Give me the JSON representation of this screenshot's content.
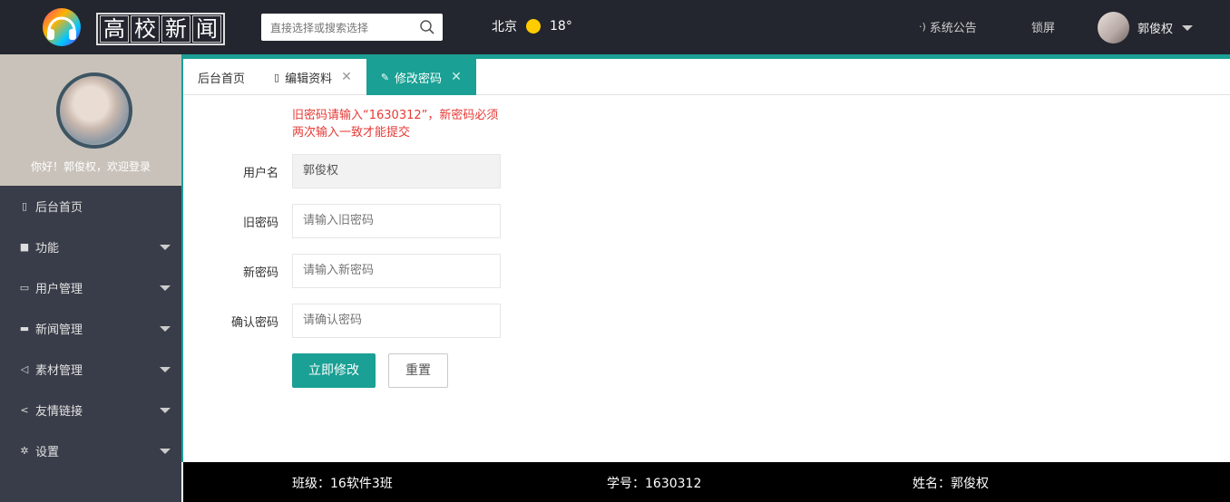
{
  "header": {
    "logo_chars": [
      "高",
      "校",
      "新",
      "闻"
    ],
    "search_placeholder": "直接选择或搜索选择",
    "weather_city": "北京",
    "weather_temp": "18°",
    "notice_label": "系统公告",
    "lock_label": "锁屏",
    "user_name": "郭俊权"
  },
  "sidebar": {
    "welcome": "你好！郭俊权，欢迎登录",
    "items": [
      {
        "label": "后台首页",
        "icon": "tablet-icon",
        "glyph": "▯",
        "has_arrow": false
      },
      {
        "label": "功能",
        "icon": "briefcase-icon",
        "glyph": "■",
        "has_arrow": true
      },
      {
        "label": "用户管理",
        "icon": "chat-icon",
        "glyph": "▭",
        "has_arrow": true
      },
      {
        "label": "新闻管理",
        "icon": "folder-icon",
        "glyph": "▬",
        "has_arrow": true
      },
      {
        "label": "素材管理",
        "icon": "paper-plane-icon",
        "glyph": "◁",
        "has_arrow": true
      },
      {
        "label": "友情链接",
        "icon": "share-icon",
        "glyph": "<",
        "has_arrow": true
      },
      {
        "label": "设置",
        "icon": "gear-icon",
        "glyph": "✲",
        "has_arrow": true
      }
    ]
  },
  "tabs": [
    {
      "label": "后台首页",
      "closable": false,
      "active": false
    },
    {
      "label": "编辑资料",
      "closable": true,
      "active": false,
      "icon": "document-icon"
    },
    {
      "label": "修改密码",
      "closable": true,
      "active": true,
      "icon": "pencil-icon"
    }
  ],
  "form": {
    "hint": "旧密码请输入“1630312”，新密码必须两次输入一致才能提交",
    "username_label": "用户名",
    "username_value": "郭俊权",
    "old_label": "旧密码",
    "old_placeholder": "请输入旧密码",
    "new_label": "新密码",
    "new_placeholder": "请输入新密码",
    "confirm_label": "确认密码",
    "confirm_placeholder": "请确认密码",
    "submit_label": "立即修改",
    "reset_label": "重置"
  },
  "footer": {
    "class": "班级：16软件3班",
    "student_id": "学号：1630312",
    "name": "姓名：郭俊权"
  },
  "colors": {
    "accent": "#1aa094",
    "header_bg": "#23262e",
    "sidebar_bg": "#393d49",
    "hint": "#e53935"
  }
}
